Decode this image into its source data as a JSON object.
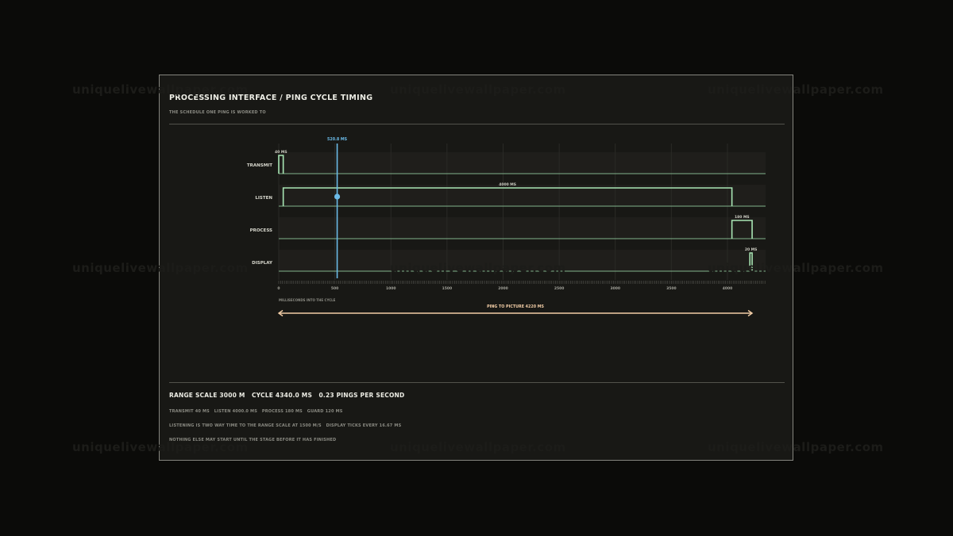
{
  "watermark": "uniquelivewallpaper.com",
  "header": {
    "title": "PROCESSING INTERFACE / PING CYCLE TIMING",
    "subtitle": "THE SCHEDULE ONE PING IS WORKED TO"
  },
  "chart_data": {
    "type": "timing",
    "x_unit": "MS",
    "xlim": [
      0,
      4340
    ],
    "x_ticks": [
      0,
      500,
      1000,
      1500,
      2000,
      2500,
      3000,
      3500,
      4000
    ],
    "xlabel": "MILLISECONDS INTO THE CYCLE",
    "lanes": [
      {
        "name": "TRANSMIT",
        "start": 0,
        "end": 40,
        "label": "40 MS"
      },
      {
        "name": "LISTEN",
        "start": 40,
        "end": 4040,
        "label": "4000 MS"
      },
      {
        "name": "PROCESS",
        "start": 4040,
        "end": 4220,
        "label": "180 MS"
      },
      {
        "name": "DISPLAY",
        "start": 4200,
        "end": 4220,
        "label": "20 MS"
      }
    ],
    "cursor": {
      "value": 520.8,
      "label": "520.8 MS"
    },
    "span": {
      "start": 0,
      "end": 4220,
      "label": "PING TO PICTURE 4220 MS"
    },
    "colors": {
      "pulse": "#a8e6b4",
      "baseline": "#82b48c",
      "cursor": "#6bbbe8",
      "span": "#f2cda6"
    }
  },
  "summary": "RANGE SCALE 3000 M   CYCLE 4340.0 MS   0.23 PINGS PER SECOND",
  "notes": [
    "TRANSMIT 40 MS   LISTEN 4000.0 MS   PROCESS 180 MS   GUARD 120 MS",
    "LISTENING IS TWO WAY TIME TO THE RANGE SCALE AT 1500 M/S   DISPLAY TICKS EVERY 16.67 MS",
    "NOTHING ELSE MAY START UNTIL THE STAGE BEFORE IT HAS FINISHED"
  ]
}
